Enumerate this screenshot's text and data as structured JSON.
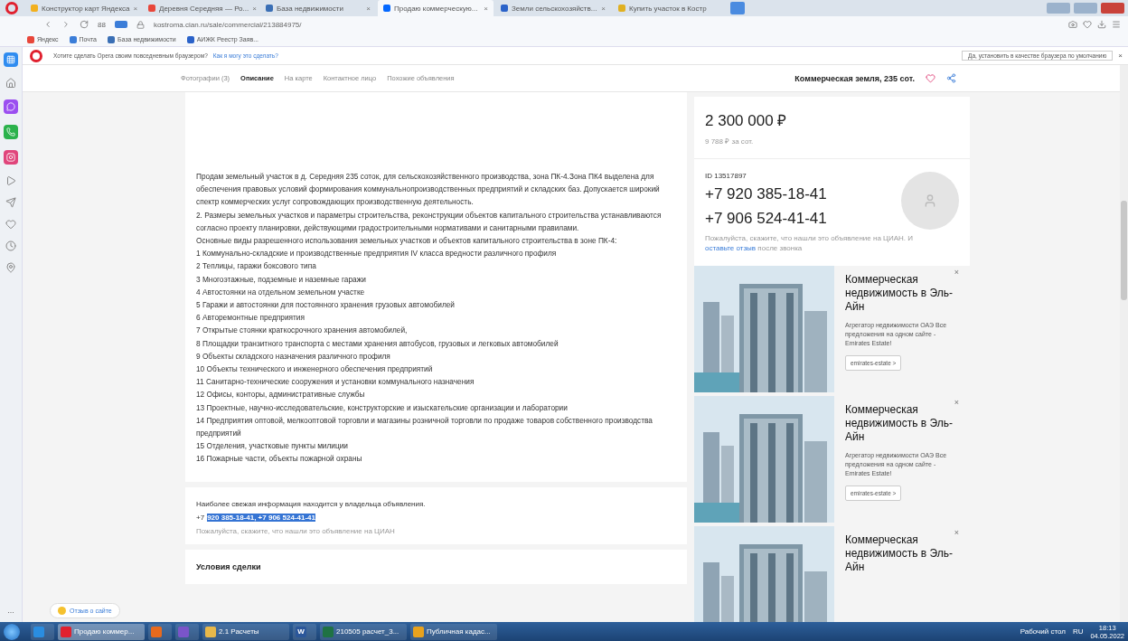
{
  "browser": {
    "tabs": [
      {
        "title": "Конструктор карт Яндекса",
        "selected": false,
        "color": "#f2b01e",
        "close": "×"
      },
      {
        "title": "Деревня Середняя — Ро...",
        "selected": false,
        "color": "#e8463a",
        "close": "×"
      },
      {
        "title": "База недвижимости",
        "selected": false,
        "color": "#3a6fb5",
        "close": "×"
      },
      {
        "title": "Продаю коммерческую...",
        "selected": true,
        "color": "#0468ff",
        "close": "×"
      },
      {
        "title": "Земли сельскохозяйств...",
        "selected": false,
        "color": "#2a62c9",
        "close": "×"
      },
      {
        "title": "Купить участок в Костр",
        "selected": false,
        "color": "#e0b020"
      }
    ],
    "address": "kostroma.cian.ru/sale/commercial/213884975/",
    "speed_dial": "88",
    "bookmarks": [
      {
        "label": "Яндекс",
        "color": "#e8463a"
      },
      {
        "label": "Почта",
        "color": "#3b7dd8"
      },
      {
        "label": "База недвижимости",
        "color": "#3a6fb5"
      },
      {
        "label": "АИЖК Реестр Заяв...",
        "color": "#2a62c9"
      }
    ],
    "infobar": {
      "message": "Хотите сделать Opera своим повседневным браузером?",
      "link": "Как я могу это сделать?",
      "button": "Да, установить в качестве браузера по умолчанию",
      "close": "×"
    },
    "sidebar_icons": [
      {
        "kind": "app",
        "color": "#2f8cf0"
      },
      {
        "kind": "home"
      },
      {
        "kind": "messenger",
        "color": "#9b4ff0"
      },
      {
        "kind": "whatsapp",
        "color": "#2bb24c"
      },
      {
        "kind": "instagram",
        "color": "#e0457b"
      },
      {
        "kind": "player"
      },
      {
        "kind": "send"
      },
      {
        "kind": "heart"
      },
      {
        "kind": "history"
      },
      {
        "kind": "pin"
      }
    ],
    "sidebar_more": "..."
  },
  "nav": {
    "tabs": [
      {
        "label": "Фотографии (3)",
        "selected": false
      },
      {
        "label": "Описание",
        "selected": true
      },
      {
        "label": "На карте",
        "selected": false
      },
      {
        "label": "Контактное лицо",
        "selected": false
      },
      {
        "label": "Похожие объявления",
        "selected": false
      }
    ],
    "title": "Коммерческая земля, 235 сот.",
    "favorite": false
  },
  "description": [
    "Продам земельный участок в д. Середняя  235 соток, для сельскохозяйственного производства, зона ПК-4.Зона ПК4 выделена для обеспечения правовых условий формирования коммунальнопроизводственных предприятий и складских баз. Допускается широкий спектр коммерческих услуг сопровождающих производственную деятельность.",
    "2. Размеры земельных участков и параметры строительства, реконструкции объектов капитального строительства устанавливаются согласно проекту планировки, действующими градостроительными нормативами и санитарными правилами.",
    "Основные виды разрешенного использования земельных участков и объектов капитального строительства в зоне ПК-4:",
    "1 Коммунально-складские и производственные предприятия IV класса вредности различного профиля",
    "2 Теплицы, гаражи боксового типа",
    "3 Многоэтажные, подземные и наземные гаражи",
    "4 Автостоянки на отдельном земельном участке",
    "5 Гаражи и автостоянки для постоянного хранения грузовых автомобилей",
    "6 Авторемонтные предприятия",
    "7 Открытые стоянки краткосрочного хранения автомобилей,",
    "8 Площадки транзитного транспорта с местами хранения автобусов, грузовых и легковых автомобилей",
    "9 Объекты складского назначения различного профиля",
    "10 Объекты технического и инженерного обеспечения предприятий",
    "11 Санитарно-технические сооружения и установки коммунального назначения",
    "12 Офисы, конторы, административные службы",
    "13 Проектные, научно-исследовательские, конструкторские и изыскательские организации и лаборатории",
    "14 Предприятия оптовой, мелкооптовой торговли и магазины розничной торговли по продаже товаров собственного производства предприятий",
    "15 Отделения, участковые пункты милиции",
    "16 Пожарные части, объекты пожарной охраны"
  ],
  "owner_note": {
    "text": "Наиболее свежая информация находится у владельца объявления.",
    "phone_prefix": "+7",
    "phones": "920 385-18-41, +7 906 524-41-41",
    "phones_selected": true,
    "hint": "Пожалуйста, скажите, что нашли это объявление на ЦИАН"
  },
  "deal_title": "Условия сделки",
  "feedback": "Отзыв о сайте",
  "price": {
    "value": "2 300 000 ₽",
    "per_unit": "9 788 ₽ за сот."
  },
  "contact": {
    "id": "ID 13517897",
    "phones": [
      "+7 920 385-18-41",
      "+7 906 524-41-41"
    ],
    "hint": "Пожалуйста, скажите, что нашли это объявление на ЦИАН. И",
    "hint_link": "оставьте отзыв",
    "hint_end": "после звонка"
  },
  "ads": [
    {
      "title": "Коммерческая недвижимость в Эль-Айн",
      "text": "Агрегатор недвижимости ОАЭ Все предложения на одном сайте - Emirates Estate!",
      "button": "emirates-estate >",
      "close": "×"
    },
    {
      "title": "Коммерческая недвижимость в Эль-Айн",
      "text": "Агрегатор недвижимости ОАЭ Все предложения на одном сайте - Emirates Estate!",
      "button": "emirates-estate >",
      "close": "×"
    },
    {
      "title": "Коммерческая недвижимость в Эль-Айн",
      "close": "×"
    }
  ],
  "taskbar": {
    "items": [
      {
        "kind": "ie"
      },
      {
        "kind": "opera",
        "label": "Продаю коммер...",
        "selected": true
      },
      {
        "kind": "app"
      },
      {
        "kind": "mail"
      },
      {
        "kind": "folder",
        "label": "2.1 Расчеты"
      },
      {
        "kind": "word",
        "letter": "W"
      },
      {
        "kind": "excel",
        "label": "210505 расчет_3..."
      },
      {
        "kind": "chrome",
        "label": "Публичная кадас..."
      }
    ],
    "desktop": "Рабочий стол",
    "lang": "RU",
    "time": "18:13",
    "date": "04.05.2022"
  }
}
